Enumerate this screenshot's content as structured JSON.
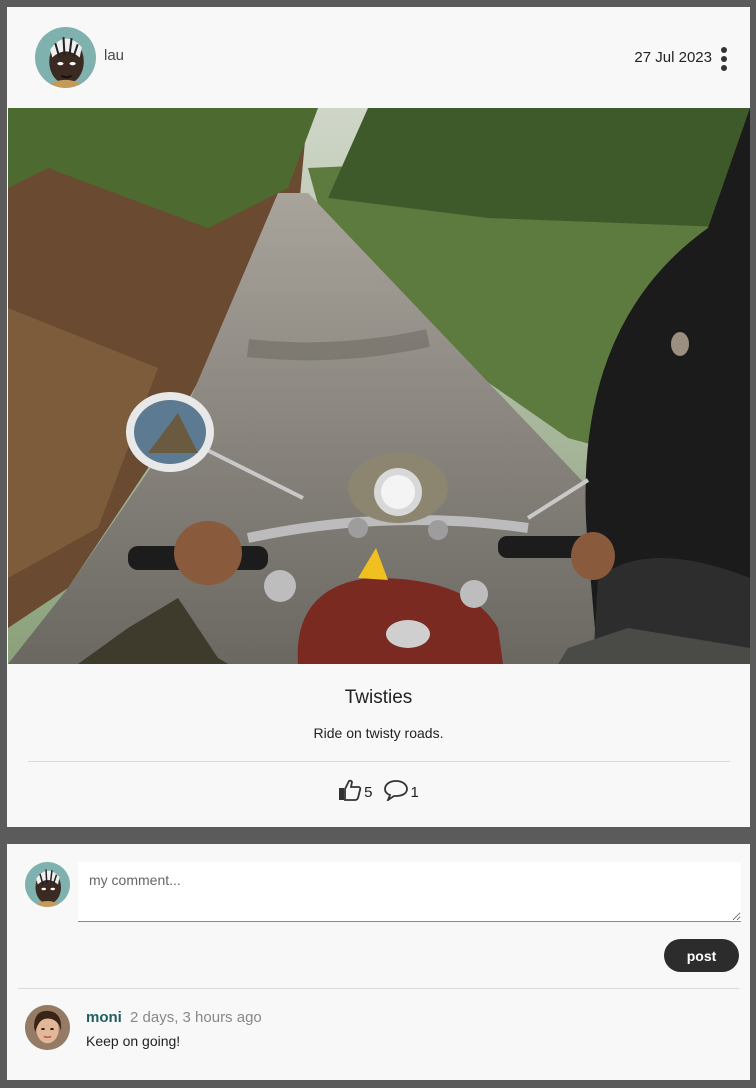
{
  "post": {
    "author": "lau",
    "date": "27 Jul 2023",
    "title": "Twisties",
    "description": "Ride on twisty roads.",
    "likes": "5",
    "comments_count": "1",
    "photo_subject": "motorcycle rider POV on forest road",
    "icons": {
      "menu": "kebab-menu-icon",
      "like": "thumbs-up-icon",
      "comment": "speech-bubble-icon"
    }
  },
  "comment_form": {
    "placeholder": "my comment...",
    "submit_label": "post"
  },
  "comments": [
    {
      "author": "moni",
      "time": "2 days, 3 hours ago",
      "text": "Keep on going!"
    }
  ],
  "colors": {
    "page_bg": "#5b5b5b",
    "card_bg": "#f8f8f8",
    "button_bg": "#2c2c2c",
    "comment_author": "#1f5f5f"
  }
}
